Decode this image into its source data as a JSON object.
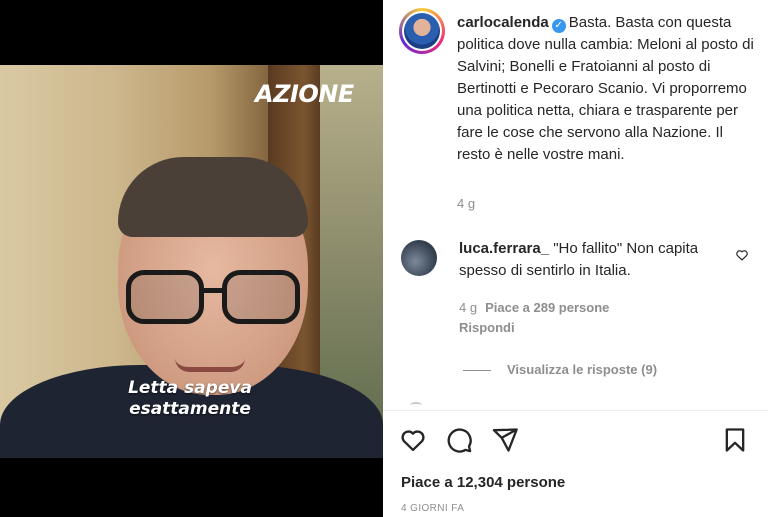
{
  "media": {
    "brand_logo": "AZIONE",
    "caption_line1": "Letta sapeva",
    "caption_line2": "esattamente"
  },
  "post": {
    "username": "carlocalenda",
    "verified": true,
    "caption": "Basta. Basta con questa politica dove nulla cambia: Meloni al posto di Salvini; Bonelli e Fratoianni al posto di Bertinotti e Pecoraro Scanio. Vi proporremo una politica netta, chiara e trasparente per fare le cose che servono alla Nazione. Il resto è nelle vostre mani.",
    "age": "4 g"
  },
  "comment": {
    "username": "luca.ferrara_",
    "text": "\"Ho fallito\" Non capita spesso di sentirlo in Italia.",
    "age": "4 g",
    "likes": "Piace a 289 persone",
    "reply_label": "Rispondi",
    "view_replies": "Visualizza le risposte (9)"
  },
  "actions": {
    "icons": [
      "heart-icon",
      "comment-icon",
      "share-icon",
      "bookmark-icon"
    ]
  },
  "footer": {
    "likes_total": "Piace a 12,304 persone",
    "time_ago": "4 GIORNI FA"
  },
  "colors": {
    "text": "#262626",
    "muted": "#8e8e8e",
    "verified": "#3897f0",
    "divider": "#dbdbdb"
  }
}
